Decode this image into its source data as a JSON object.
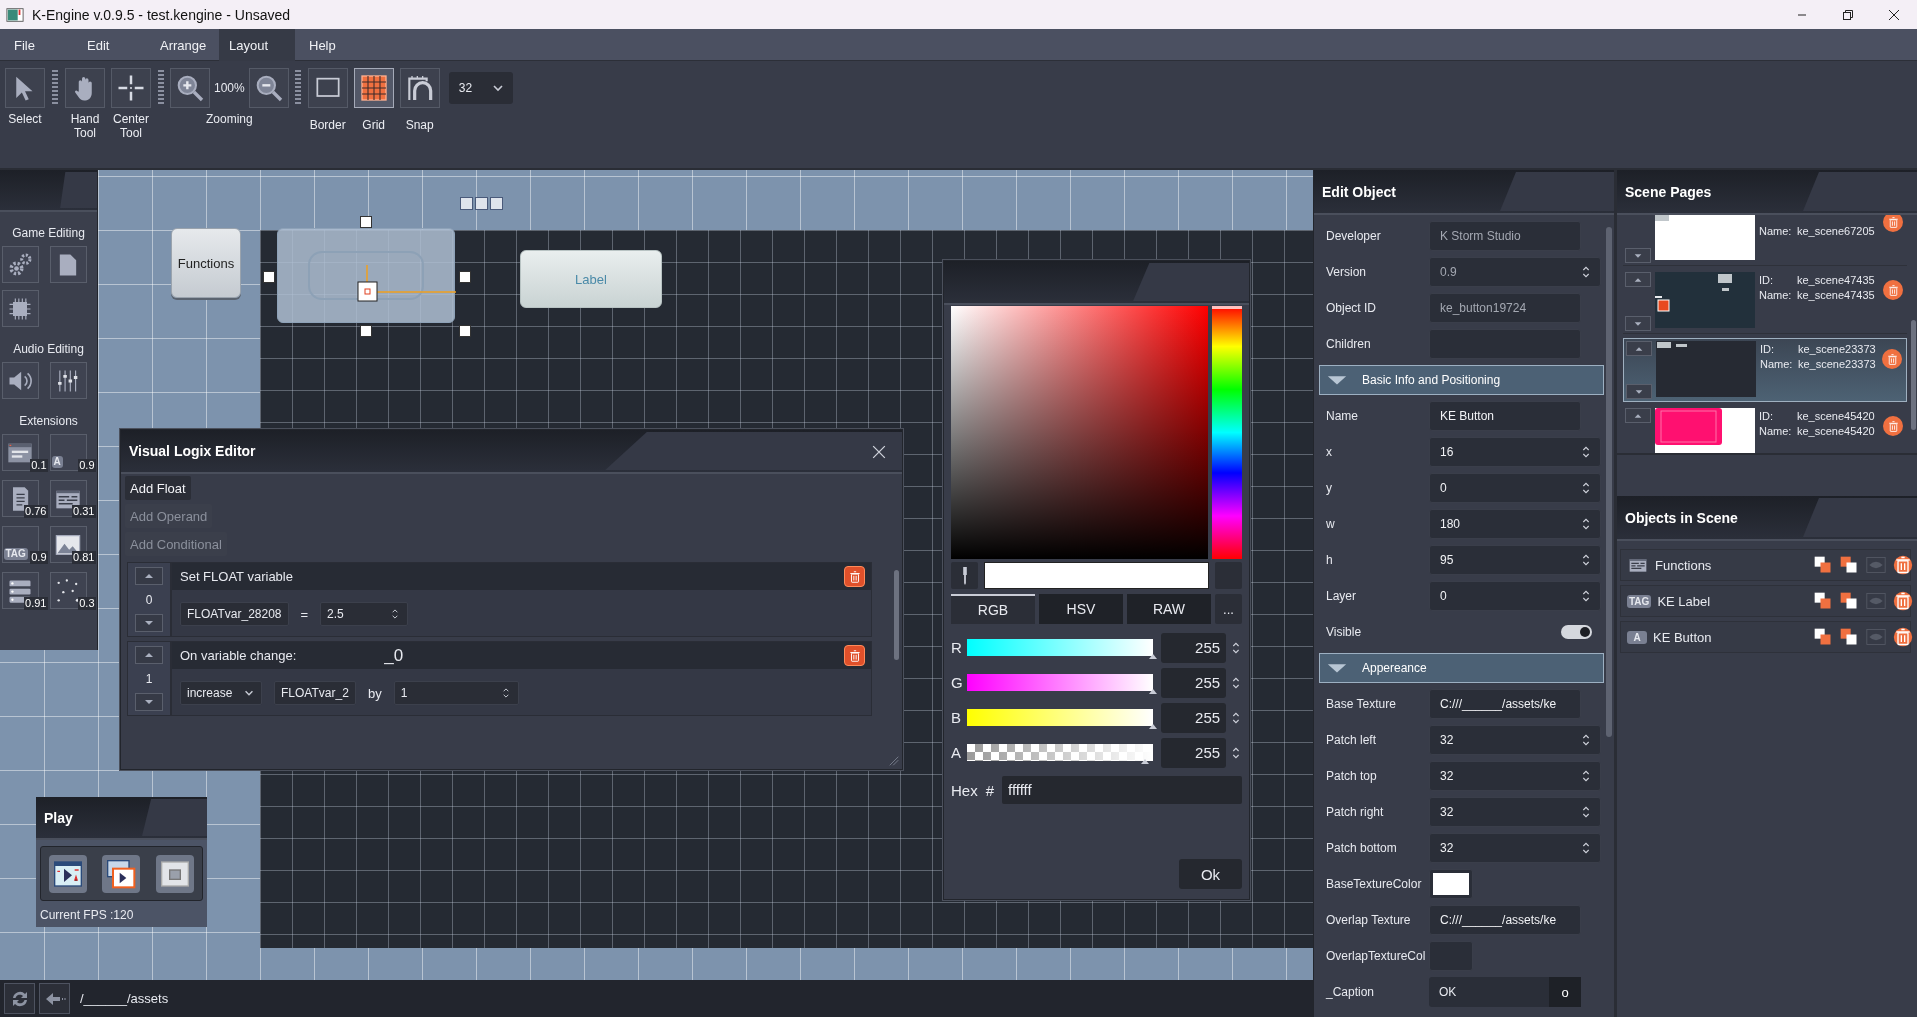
{
  "window": {
    "title": "K-Engine v.0.9.5 - test.kengine - Unsaved"
  },
  "menu": [
    {
      "label": "File",
      "selected": false
    },
    {
      "label": "Edit",
      "selected": false
    },
    {
      "label": "Arrange",
      "selected": false
    },
    {
      "label": "Layout",
      "selected": true
    },
    {
      "label": "Help",
      "selected": false
    }
  ],
  "toolbar": {
    "tools": [
      {
        "label": "Select"
      },
      {
        "label": "Hand Tool"
      },
      {
        "label": "Center Tool"
      }
    ],
    "zoom": {
      "value": "100%",
      "label": "Zooming"
    },
    "toggles": [
      {
        "label": "Border",
        "on": false
      },
      {
        "label": "Grid",
        "on": true
      },
      {
        "label": "Snap",
        "on": false
      }
    ],
    "grid_size": "32"
  },
  "toolbox": {
    "sections": [
      {
        "title": "Game Editing"
      },
      {
        "title": "Audio Editing"
      },
      {
        "title": "Extensions",
        "items": [
          {
            "version": "0.1"
          },
          {
            "glyph": "A",
            "version": "0.9"
          },
          {
            "version": "0.76"
          },
          {
            "version": "0.31"
          },
          {
            "glyph": "TAG",
            "version": "0.9"
          },
          {
            "version": "0.81"
          },
          {
            "version": "0.91"
          },
          {
            "version": "0.3"
          }
        ]
      }
    ]
  },
  "canvas": {
    "objects": [
      {
        "kind": "button",
        "text": "Functions",
        "selected": false
      },
      {
        "kind": "button",
        "selected": true
      },
      {
        "kind": "label",
        "text": "Label",
        "selected": false
      }
    ]
  },
  "logix": {
    "title": "Visual Logix Editor",
    "actions": [
      {
        "label": "Add Float",
        "disabled": false
      },
      {
        "label": "Add Operand",
        "disabled": true
      },
      {
        "label": "Add Conditional",
        "disabled": true
      }
    ],
    "blocks": [
      {
        "kind": "set",
        "index": "0",
        "title": "Set FLOAT variable",
        "variable": "FLOATvar_28208",
        "operator": "=",
        "value": "2.5"
      },
      {
        "kind": "change",
        "index": "1",
        "title": "On variable change:",
        "suffix": "_0",
        "operation": "increase",
        "variable": "FLOATvar_2",
        "by": "by",
        "value": "1"
      }
    ]
  },
  "color_picker": {
    "hue_slider": {
      "level": 0
    },
    "modes": [
      {
        "label": "RGB",
        "selected": true
      },
      {
        "label": "HSV",
        "selected": false
      },
      {
        "label": "RAW",
        "selected": false
      }
    ],
    "more": "...",
    "channels": [
      {
        "name": "R",
        "level": 1,
        "value": "255"
      },
      {
        "name": "G",
        "level": 1,
        "value": "255"
      },
      {
        "name": "B",
        "level": 1,
        "value": "255"
      },
      {
        "name": "A",
        "level": 0.96,
        "value": "255"
      }
    ],
    "hex_label": "Hex",
    "hash": "#",
    "hex": "ffffff",
    "ok": "Ok"
  },
  "play": {
    "title": "Play",
    "fps": "Current FPS :120"
  },
  "status_bar": {
    "path": "/______/assets"
  },
  "edit_object": {
    "title": "Edit Object",
    "fields": [
      {
        "kind": "text",
        "label": "Developer",
        "value": "K Storm Studio",
        "disabled": true
      },
      {
        "kind": "spin",
        "label": "Version",
        "value": "0.9",
        "disabled": true
      },
      {
        "kind": "text",
        "label": "Object ID",
        "value": "ke_button19724",
        "disabled": true
      },
      {
        "kind": "text",
        "label": "Children"
      },
      {
        "kind": "section",
        "label": "Basic Info and Positioning",
        "expanded": true
      },
      {
        "kind": "text",
        "label": "Name",
        "value": "KE Button",
        "disabled": false
      },
      {
        "kind": "spin",
        "label": "x",
        "value": "16",
        "disabled": false
      },
      {
        "kind": "spin",
        "label": "y",
        "value": "0",
        "disabled": false
      },
      {
        "kind": "spin",
        "label": "w",
        "value": "180",
        "disabled": false
      },
      {
        "kind": "spin",
        "label": "h",
        "value": "95",
        "disabled": false
      },
      {
        "kind": "spin",
        "label": "Layer",
        "value": "0",
        "disabled": false
      },
      {
        "kind": "toggle",
        "label": "Visible",
        "on": true
      },
      {
        "kind": "section",
        "label": "Appereance",
        "expanded": true
      },
      {
        "kind": "text",
        "label": "Base Texture",
        "value": "C:///______/assets/ke",
        "disabled": false
      },
      {
        "kind": "spin",
        "label": "Patch left",
        "value": "32",
        "disabled": false
      },
      {
        "kind": "spin",
        "label": "Patch top",
        "value": "32",
        "disabled": false
      },
      {
        "kind": "spin",
        "label": "Patch right",
        "value": "32",
        "disabled": false
      },
      {
        "kind": "spin",
        "label": "Patch bottom",
        "value": "32",
        "disabled": false
      },
      {
        "kind": "color",
        "label": "BaseTextureColor",
        "color": "#ffffff"
      },
      {
        "kind": "text",
        "label": "Overlap Texture",
        "value": "C:///______/assets/ke",
        "disabled": false
      },
      {
        "kind": "color",
        "label": "OverlapTextureCol"
      },
      {
        "kind": "caption",
        "label": "_Caption",
        "value": "OK",
        "button": "o"
      }
    ]
  },
  "scene_pages": {
    "title": "Scene Pages",
    "pages": [
      {
        "name_label": "Name:",
        "name": "ke_scene67205",
        "selected": false
      },
      {
        "id_label": "ID:",
        "id": "ke_scene47435",
        "name_label": "Name:",
        "name": "ke_scene47435",
        "selected": false
      },
      {
        "id_label": "ID:",
        "id": "ke_scene23373",
        "name_label": "Name:",
        "name": "ke_scene23373",
        "selected": true
      },
      {
        "id_label": "ID:",
        "id": "ke_scene45420",
        "name_label": "Name:",
        "name": "ke_scene45420",
        "selected": false
      }
    ]
  },
  "objects_in_scene": {
    "title": "Objects in Scene",
    "items": [
      {
        "label": "Functions"
      },
      {
        "glyph": "TAG",
        "label": "KE Label"
      },
      {
        "glyph": "A",
        "label": "KE Button"
      }
    ]
  }
}
